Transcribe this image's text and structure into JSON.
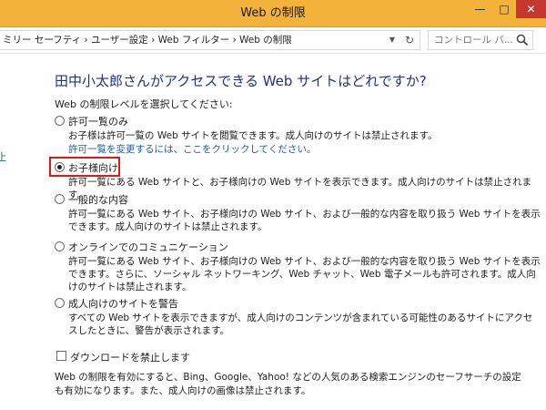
{
  "window": {
    "title": "Web の制限",
    "minimize_glyph": "—",
    "maximize_glyph": "□",
    "close_glyph": "✕"
  },
  "address_bar": {
    "breadcrumb": "ミリー セーフティ › ユーザー設定 › Web フィルター › Web の制限",
    "dropdown_icon": "chevron-down-icon",
    "refresh_glyph": "↻",
    "search_placeholder": "コントロール パ..."
  },
  "left_panel": {
    "link_text": "止"
  },
  "main": {
    "heading": "田中小太郎さんがアクセスできる Web サイトはどれですか?",
    "subtext": "Web の制限レベルを選択してください:",
    "options": [
      {
        "label": "許可一覧のみ",
        "desc": "お子様は許可一覧の Web サイトを閲覧できます。成人向けのサイトは禁止されます。",
        "link": "許可一覧を変更するには、ここをクリックしてください。",
        "selected": false
      },
      {
        "label": "お子様向け",
        "desc": "許可一覧にある Web サイトと、お子様向けの Web サイトを表示できます。成人向けのサイトは禁止されます。",
        "selected": true
      },
      {
        "label": "一般的な内容",
        "desc": "許可一覧にある Web サイト、お子様向けの Web サイト、および一般的な内容を取り扱う Web サイトを表示できます。成人向けのサイトは禁止されます。",
        "selected": false
      },
      {
        "label": "オンラインでのコミュニケーション",
        "desc": "許可一覧にある Web サイト、お子様向けの Web サイト、および一般的な内容を取り扱う Web サイトを表示できます。さらに、ソーシャル ネットワーキング、Web チャット、Web 電子メールも許可されます。成人向けのサイトは禁止されます。",
        "selected": false
      },
      {
        "label": "成人向けのサイトを警告",
        "desc": "すべての Web サイトを表示できますが、成人向けのコンテンツが含まれている可能性のあるサイトにアクセスしたときに、警告が表示されます。",
        "selected": false
      }
    ],
    "download_block_label": "ダウンロードを禁止します",
    "download_block_checked": false,
    "footnote": "Web の制限を有効にすると、Bing、Google、Yahoo! などの人気のある検索エンジンのセーフサーチの設定も有効になります。また、成人向けの画像は禁止されます。"
  },
  "colors": {
    "titlebar": "#f3b33b",
    "heading": "#1e3287",
    "link": "#1a5fb4",
    "highlight": "#e01818",
    "close_button": "#c7372f"
  }
}
